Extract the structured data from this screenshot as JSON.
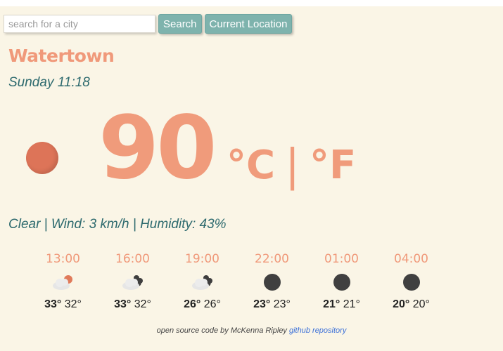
{
  "search": {
    "placeholder": "search for a city",
    "value": ""
  },
  "buttons": {
    "search_label": "Search",
    "location_label": "Current Location"
  },
  "weather": {
    "city": "Watertown",
    "datetime": "Sunday 11:18",
    "temperature": "90",
    "unit_c": "°C",
    "unit_separator": "|",
    "unit_f": "°F",
    "conditions": "Clear | Wind: 3 km/h | Humidity: 43%",
    "icon": "sun-icon"
  },
  "forecast": [
    {
      "time": "13:00",
      "high": "33°",
      "low": "32°",
      "icon": "partly-cloudy-day-icon"
    },
    {
      "time": "16:00",
      "high": "33°",
      "low": "32°",
      "icon": "partly-cloudy-night-icon"
    },
    {
      "time": "19:00",
      "high": "26°",
      "low": "26°",
      "icon": "partly-cloudy-night-icon"
    },
    {
      "time": "22:00",
      "high": "23°",
      "low": "23°",
      "icon": "clear-night-icon"
    },
    {
      "time": "01:00",
      "high": "21°",
      "low": "21°",
      "icon": "clear-night-icon"
    },
    {
      "time": "04:00",
      "high": "20°",
      "low": "20°",
      "icon": "clear-night-icon"
    }
  ],
  "footer": {
    "text": "open source code by McKenna Ripley",
    "link_label": "github repository"
  },
  "colors": {
    "background": "#faf5e6",
    "accent": "#f0997a",
    "teal": "#2d6a6e",
    "button": "#7eb3ad"
  }
}
